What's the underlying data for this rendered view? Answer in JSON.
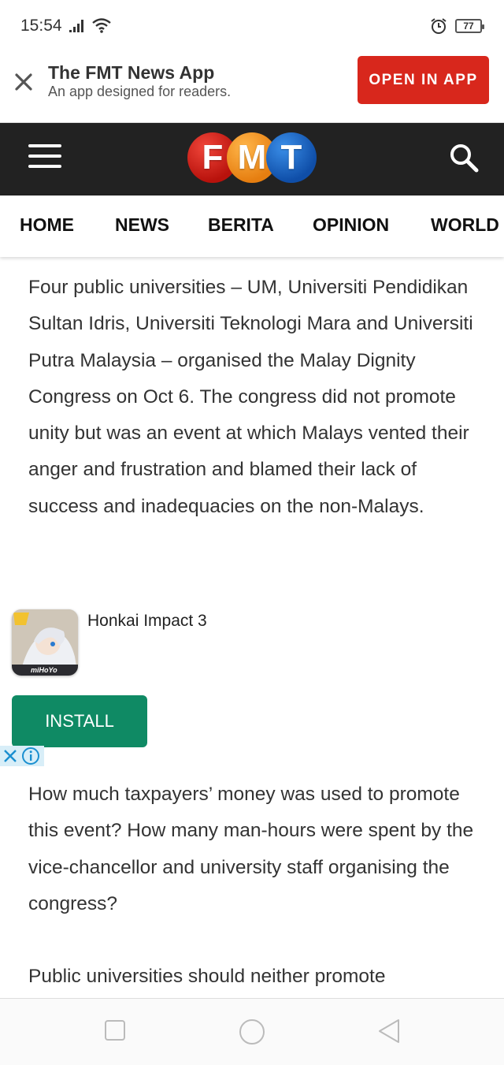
{
  "status_bar": {
    "time": "15:54",
    "battery": "77",
    "icons": [
      "signal-icon",
      "wifi-icon",
      "alarm-icon",
      "battery-icon"
    ]
  },
  "app_banner": {
    "title": "The FMT News App",
    "subtitle": "An app designed for readers.",
    "open_button": "OPEN IN APP",
    "accent_color": "#d8271c"
  },
  "header": {
    "logo_letters": [
      "F",
      "M",
      "T"
    ],
    "logo_colors": [
      "#c8160f",
      "#f28c1f",
      "#1a64c4"
    ],
    "background": "#222222"
  },
  "nav": {
    "items": [
      "HOME",
      "NEWS",
      "BERITA",
      "OPINION",
      "WORLD"
    ]
  },
  "article": {
    "paragraphs": [
      "Four public universities – UM, Universiti Pendidikan Sultan Idris, Universiti Teknologi Mara and Universiti Putra Malaysia – organised the Malay Dignity Congress on Oct 6. The congress did not promote unity but was an event at which Malays vented their anger and frustration and blamed their lack of success and inadequacies on the non-Malays.",
      "How much taxpayers’ money was used to promote this event? How many man-hours were spent by the vice-chancellor and university staff organising the congress?",
      "Public universities should neither promote"
    ]
  },
  "ad": {
    "app_name": "Honkai Impact 3",
    "install_label": "INSTALL",
    "install_color": "#0f8a64",
    "icon_badge": "miHoYo"
  },
  "system_nav": {
    "buttons": [
      "recents-icon",
      "home-icon",
      "back-icon"
    ]
  }
}
